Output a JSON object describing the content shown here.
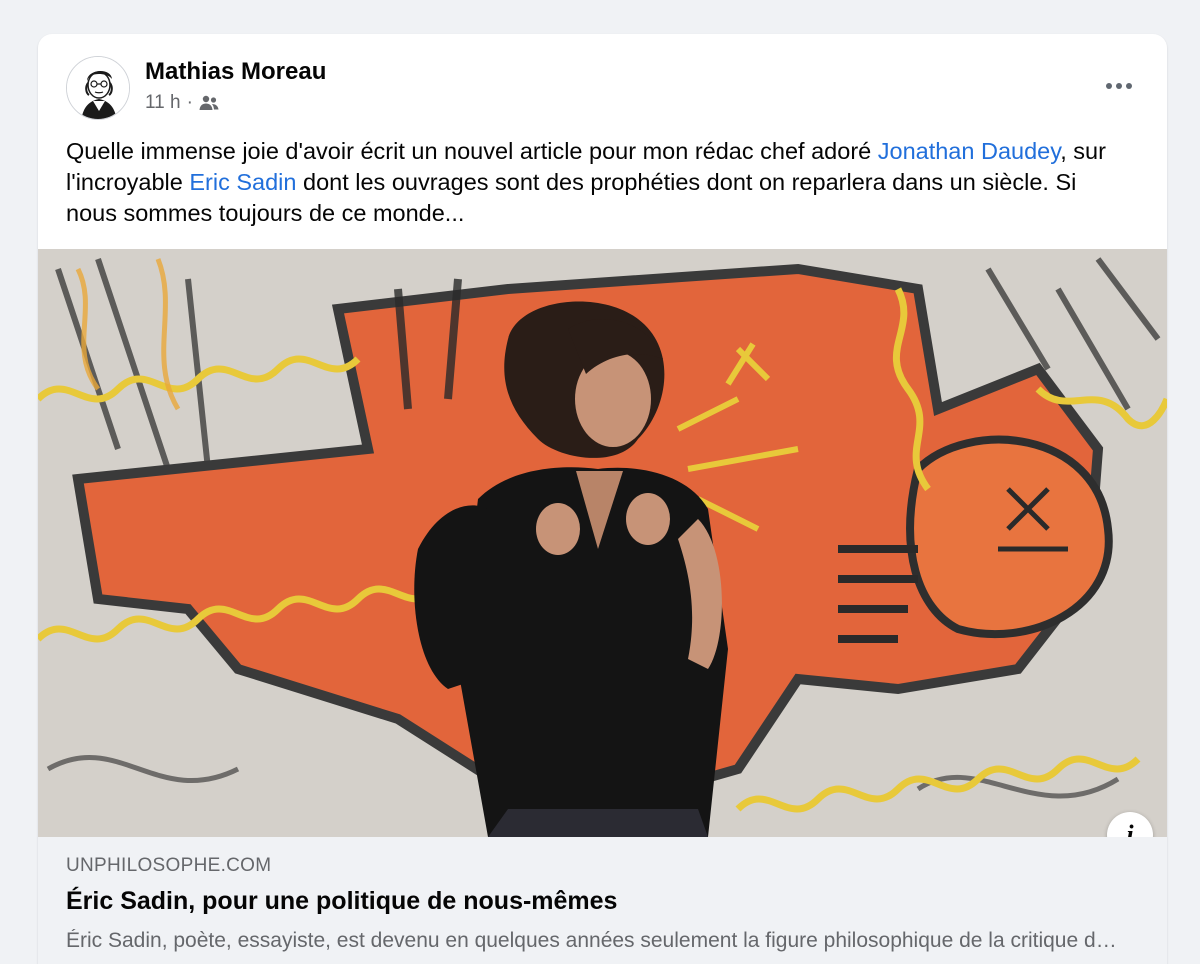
{
  "post": {
    "author": "Mathias Moreau",
    "time": "11 h",
    "separator": "·",
    "audience_icon": "friends-icon",
    "more_icon": "more-options-icon",
    "text": {
      "part1": "Quelle immense joie d'avoir écrit un nouvel article pour mon rédac chef adoré ",
      "mention1": "Jonathan Daudey",
      "part2": ", sur l'incroyable ",
      "mention2": "Eric Sadin",
      "part3": " dont les ouvrages sont des prophéties dont on reparlera dans un siècle. Si nous sommes toujours de ce monde..."
    }
  },
  "link_preview": {
    "info_label": "i",
    "domain": "UNPHILOSOPHE.COM",
    "title": "Éric Sadin, pour une politique de nous-mêmes",
    "description": "Éric Sadin, poète, essayiste, est devenu en quelques années seulement la figure philosophique de la critique des technologies numériques"
  },
  "colors": {
    "mention": "#216fdb",
    "secondary_text": "#65676b",
    "background": "#f0f2f5"
  }
}
